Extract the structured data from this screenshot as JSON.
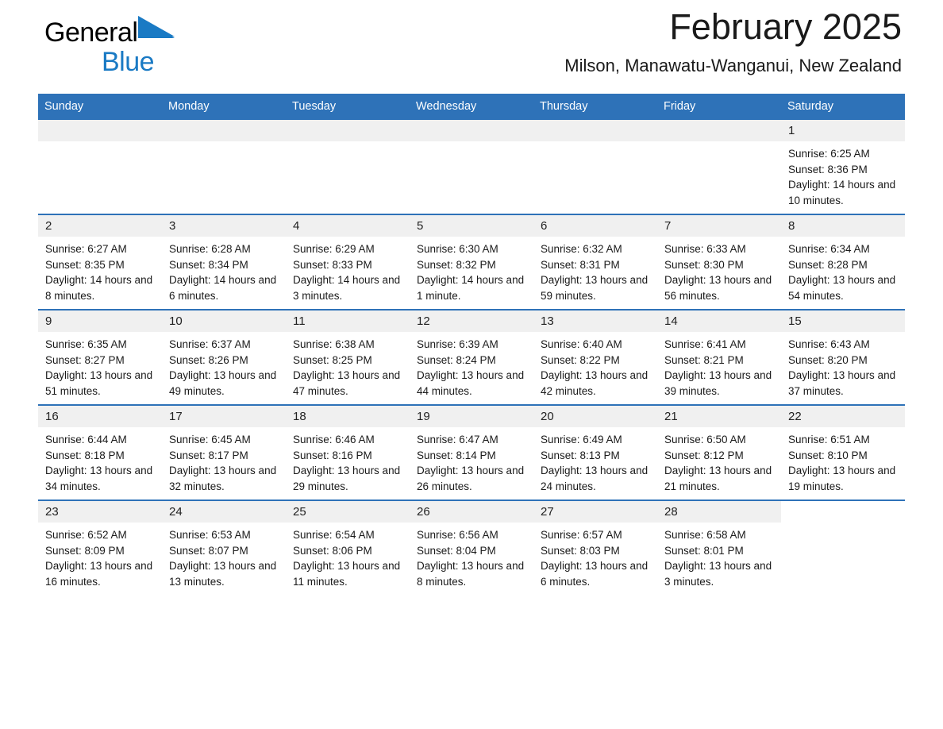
{
  "brand": {
    "name_part1": "General",
    "name_part2": "Blue",
    "logo_icon": "blue-triangle-icon",
    "accent_color": "#1a7ac4"
  },
  "header": {
    "month_title": "February 2025",
    "location": "Milson, Manawatu-Wanganui, New Zealand"
  },
  "theme": {
    "header_blue": "#2e72b8",
    "daynum_grey": "#f0f0f0",
    "text_color": "#1a1a1a"
  },
  "calendar": {
    "weekday_headers": [
      "Sunday",
      "Monday",
      "Tuesday",
      "Wednesday",
      "Thursday",
      "Friday",
      "Saturday"
    ],
    "weeks": [
      [
        {
          "day": "",
          "empty": true
        },
        {
          "day": "",
          "empty": true
        },
        {
          "day": "",
          "empty": true
        },
        {
          "day": "",
          "empty": true
        },
        {
          "day": "",
          "empty": true
        },
        {
          "day": "",
          "empty": true
        },
        {
          "day": "1",
          "sunrise": "Sunrise: 6:25 AM",
          "sunset": "Sunset: 8:36 PM",
          "daylight": "Daylight: 14 hours and 10 minutes."
        }
      ],
      [
        {
          "day": "2",
          "sunrise": "Sunrise: 6:27 AM",
          "sunset": "Sunset: 8:35 PM",
          "daylight": "Daylight: 14 hours and 8 minutes."
        },
        {
          "day": "3",
          "sunrise": "Sunrise: 6:28 AM",
          "sunset": "Sunset: 8:34 PM",
          "daylight": "Daylight: 14 hours and 6 minutes."
        },
        {
          "day": "4",
          "sunrise": "Sunrise: 6:29 AM",
          "sunset": "Sunset: 8:33 PM",
          "daylight": "Daylight: 14 hours and 3 minutes."
        },
        {
          "day": "5",
          "sunrise": "Sunrise: 6:30 AM",
          "sunset": "Sunset: 8:32 PM",
          "daylight": "Daylight: 14 hours and 1 minute."
        },
        {
          "day": "6",
          "sunrise": "Sunrise: 6:32 AM",
          "sunset": "Sunset: 8:31 PM",
          "daylight": "Daylight: 13 hours and 59 minutes."
        },
        {
          "day": "7",
          "sunrise": "Sunrise: 6:33 AM",
          "sunset": "Sunset: 8:30 PM",
          "daylight": "Daylight: 13 hours and 56 minutes."
        },
        {
          "day": "8",
          "sunrise": "Sunrise: 6:34 AM",
          "sunset": "Sunset: 8:28 PM",
          "daylight": "Daylight: 13 hours and 54 minutes."
        }
      ],
      [
        {
          "day": "9",
          "sunrise": "Sunrise: 6:35 AM",
          "sunset": "Sunset: 8:27 PM",
          "daylight": "Daylight: 13 hours and 51 minutes."
        },
        {
          "day": "10",
          "sunrise": "Sunrise: 6:37 AM",
          "sunset": "Sunset: 8:26 PM",
          "daylight": "Daylight: 13 hours and 49 minutes."
        },
        {
          "day": "11",
          "sunrise": "Sunrise: 6:38 AM",
          "sunset": "Sunset: 8:25 PM",
          "daylight": "Daylight: 13 hours and 47 minutes."
        },
        {
          "day": "12",
          "sunrise": "Sunrise: 6:39 AM",
          "sunset": "Sunset: 8:24 PM",
          "daylight": "Daylight: 13 hours and 44 minutes."
        },
        {
          "day": "13",
          "sunrise": "Sunrise: 6:40 AM",
          "sunset": "Sunset: 8:22 PM",
          "daylight": "Daylight: 13 hours and 42 minutes."
        },
        {
          "day": "14",
          "sunrise": "Sunrise: 6:41 AM",
          "sunset": "Sunset: 8:21 PM",
          "daylight": "Daylight: 13 hours and 39 minutes."
        },
        {
          "day": "15",
          "sunrise": "Sunrise: 6:43 AM",
          "sunset": "Sunset: 8:20 PM",
          "daylight": "Daylight: 13 hours and 37 minutes."
        }
      ],
      [
        {
          "day": "16",
          "sunrise": "Sunrise: 6:44 AM",
          "sunset": "Sunset: 8:18 PM",
          "daylight": "Daylight: 13 hours and 34 minutes."
        },
        {
          "day": "17",
          "sunrise": "Sunrise: 6:45 AM",
          "sunset": "Sunset: 8:17 PM",
          "daylight": "Daylight: 13 hours and 32 minutes."
        },
        {
          "day": "18",
          "sunrise": "Sunrise: 6:46 AM",
          "sunset": "Sunset: 8:16 PM",
          "daylight": "Daylight: 13 hours and 29 minutes."
        },
        {
          "day": "19",
          "sunrise": "Sunrise: 6:47 AM",
          "sunset": "Sunset: 8:14 PM",
          "daylight": "Daylight: 13 hours and 26 minutes."
        },
        {
          "day": "20",
          "sunrise": "Sunrise: 6:49 AM",
          "sunset": "Sunset: 8:13 PM",
          "daylight": "Daylight: 13 hours and 24 minutes."
        },
        {
          "day": "21",
          "sunrise": "Sunrise: 6:50 AM",
          "sunset": "Sunset: 8:12 PM",
          "daylight": "Daylight: 13 hours and 21 minutes."
        },
        {
          "day": "22",
          "sunrise": "Sunrise: 6:51 AM",
          "sunset": "Sunset: 8:10 PM",
          "daylight": "Daylight: 13 hours and 19 minutes."
        }
      ],
      [
        {
          "day": "23",
          "sunrise": "Sunrise: 6:52 AM",
          "sunset": "Sunset: 8:09 PM",
          "daylight": "Daylight: 13 hours and 16 minutes."
        },
        {
          "day": "24",
          "sunrise": "Sunrise: 6:53 AM",
          "sunset": "Sunset: 8:07 PM",
          "daylight": "Daylight: 13 hours and 13 minutes."
        },
        {
          "day": "25",
          "sunrise": "Sunrise: 6:54 AM",
          "sunset": "Sunset: 8:06 PM",
          "daylight": "Daylight: 13 hours and 11 minutes."
        },
        {
          "day": "26",
          "sunrise": "Sunrise: 6:56 AM",
          "sunset": "Sunset: 8:04 PM",
          "daylight": "Daylight: 13 hours and 8 minutes."
        },
        {
          "day": "27",
          "sunrise": "Sunrise: 6:57 AM",
          "sunset": "Sunset: 8:03 PM",
          "daylight": "Daylight: 13 hours and 6 minutes."
        },
        {
          "day": "28",
          "sunrise": "Sunrise: 6:58 AM",
          "sunset": "Sunset: 8:01 PM",
          "daylight": "Daylight: 13 hours and 3 minutes."
        },
        {
          "day": "",
          "empty": true
        }
      ]
    ]
  }
}
